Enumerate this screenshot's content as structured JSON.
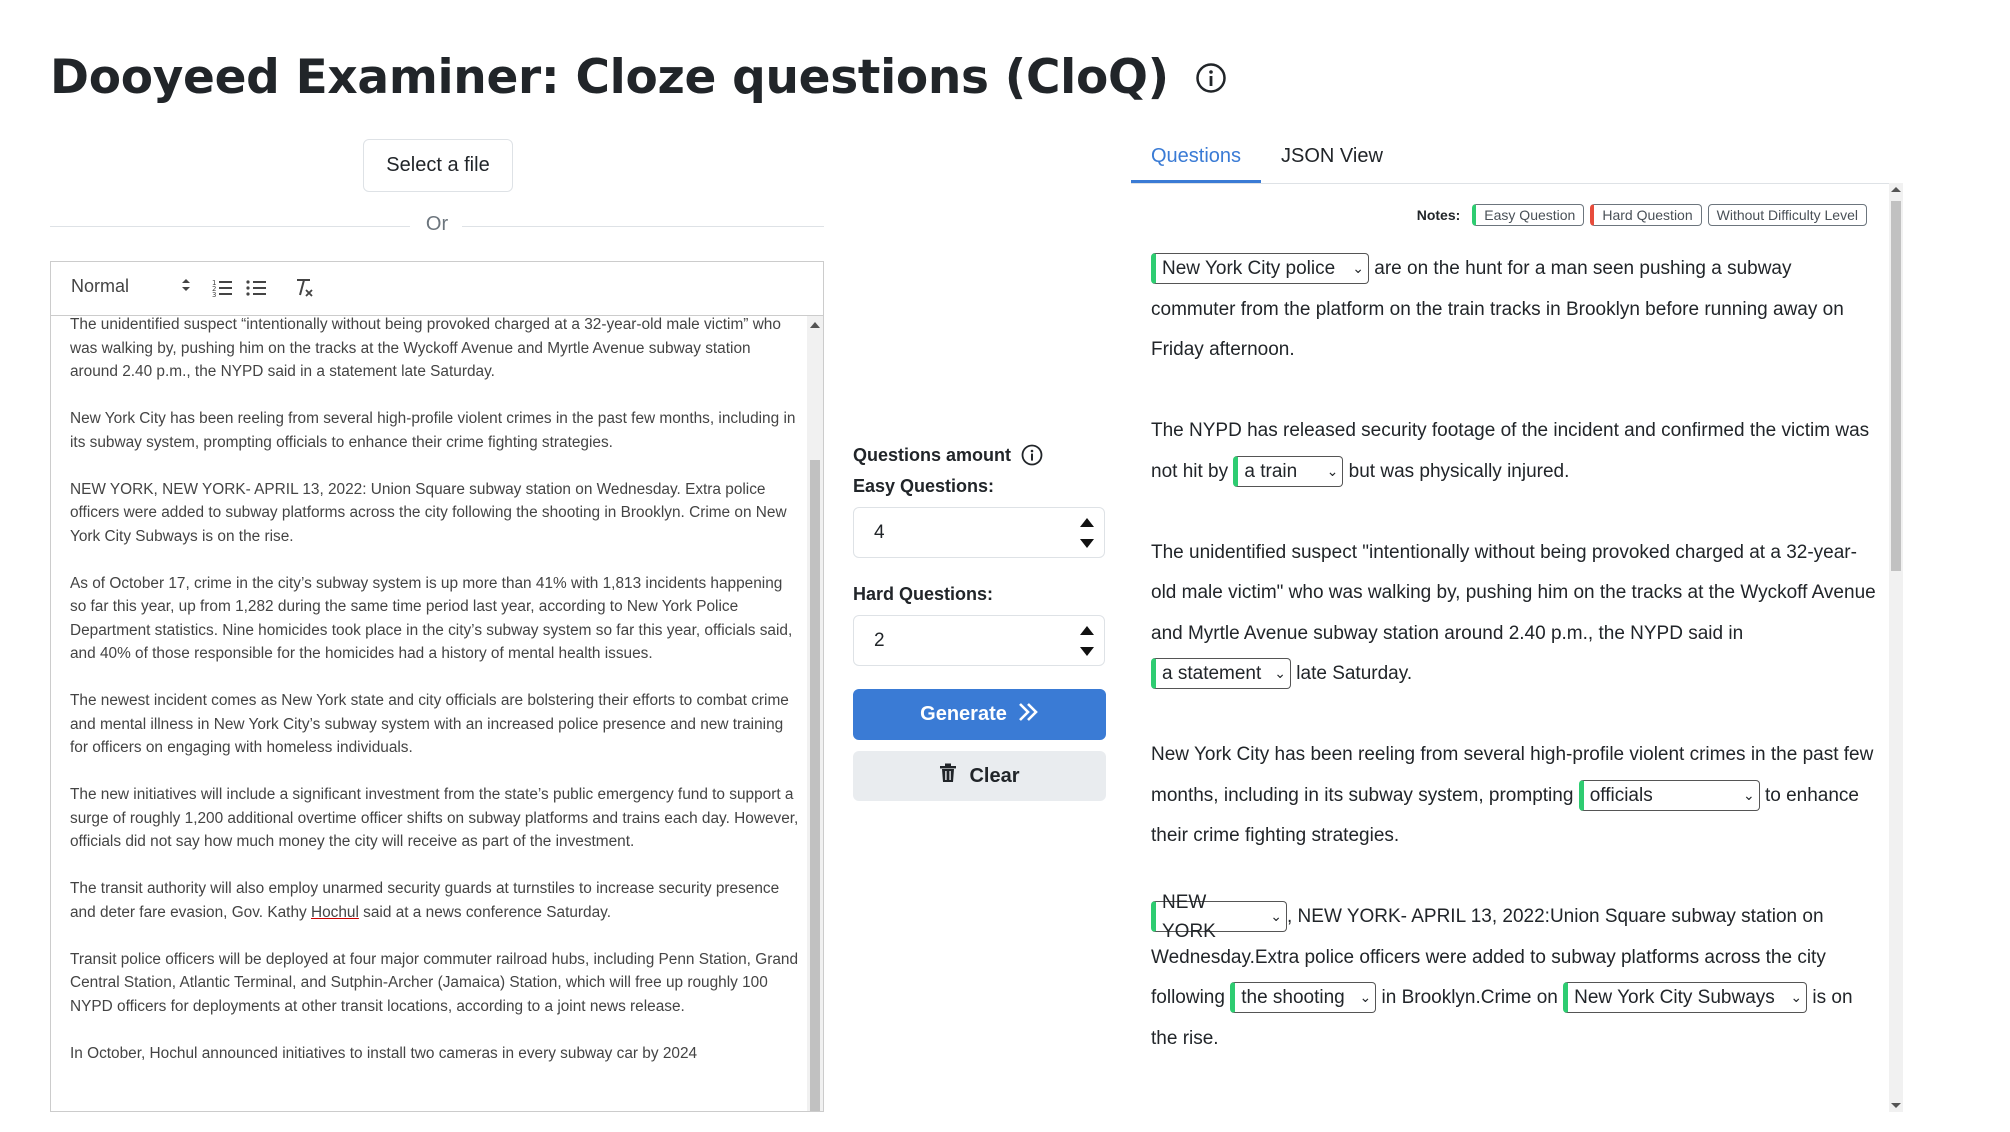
{
  "page": {
    "title": "Dooyeed Examiner: Cloze questions (CloQ)"
  },
  "left": {
    "select_file_label": "Select a file",
    "or_label": "Or",
    "format_label": "Normal",
    "paragraphs": [
      "The unidentified suspect “intentionally without being provoked charged at a 32-year-old male victim” who was walking by, pushing him on the tracks at the Wyckoff Avenue and Myrtle Avenue subway station around 2.40 p.m., the NYPD said in a statement late Saturday.",
      "New York City has been reeling from several high-profile violent crimes in the past few months, including in its subway system, prompting officials to enhance their crime fighting strategies.",
      "NEW YORK, NEW YORK- APRIL 13, 2022: Union Square subway station on Wednesday. Extra police officers were added to subway platforms across the city following the shooting in Brooklyn. Crime on New York City Subways is on the rise.",
      "As of October 17, crime in the city’s subway system is up more than 41% with 1,813 incidents happening so far this year, up from 1,282 during the same time period last year, according to New York Police Department statistics. Nine homicides took place in the city’s subway system so far this year, officials said, and 40% of those responsible for the homicides had a history of mental health issues.",
      "The newest incident comes as New York state and city officials are bolstering their efforts to combat crime and mental illness in New York City’s subway system with an increased police presence and new training for officers on engaging with homeless individuals.",
      "The new initiatives will include a significant investment from the state’s public emergency fund to support a surge of roughly 1,200 additional overtime officer shifts on subway platforms and trains each day. However, officials did not say how much money the city will receive as part of the investment.",
      {
        "before": "The transit authority will also employ unarmed security guards at turnstiles to increase security presence and deter fare evasion, Gov. Kathy ",
        "underlined": "Hochul",
        "after": " said at a news conference Saturday."
      },
      "Transit police officers will be deployed at four major commuter railroad hubs, including Penn Station, Grand Central Station, Atlantic Terminal, and Sutphin-Archer (Jamaica) Station, which will free up roughly 100 NYPD officers for deployments at other transit locations, according to a joint news release.",
      "In October, Hochul announced initiatives to install two cameras in every subway car by 2024"
    ]
  },
  "middle": {
    "questions_amount_label": "Questions amount",
    "easy_label": "Easy Questions:",
    "easy_value": "4",
    "hard_label": "Hard Questions:",
    "hard_value": "2",
    "generate_label": "Generate",
    "clear_label": "Clear"
  },
  "right": {
    "tabs": [
      "Questions",
      "JSON View"
    ],
    "notes_label": "Notes:",
    "notes": [
      "Easy Question",
      "Hard Question",
      "Without Difficulty Level"
    ],
    "colors": {
      "easy": "#2ecc71",
      "hard": "#e74c3c",
      "accent": "#3a7bd5"
    },
    "p1": {
      "blank": "New York City police",
      "after": " are on the hunt for a man seen pushing a subway commuter from the platform on the train tracks in Brooklyn before running away on Friday afternoon."
    },
    "p2": {
      "before": "The NYPD has released security footage of the incident and confirmed the victim was not hit by ",
      "blank": "a train",
      "after": " but was physically injured."
    },
    "p3": {
      "before": "The unidentified suspect \"intentionally without being provoked charged at a 32-year-old male victim\" who was walking by, pushing him on the tracks at the Wyckoff Avenue and Myrtle Avenue subway station around 2.40 p.m., the NYPD said in ",
      "blank": "a statement",
      "after": " late Saturday."
    },
    "p4": {
      "before": "New York City has been reeling from several high-profile violent crimes in the past few months, including in its subway system, prompting ",
      "blank": "officials",
      "after": " to enhance their crime fighting strategies."
    },
    "p5": {
      "blank1": "NEW YORK",
      "mid1": ", NEW YORK- APRIL 13, 2022:Union Square subway station on Wednesday.Extra police officers were added to subway platforms across the city following ",
      "blank2": "the shooting",
      "mid2": " in Brooklyn.Crime on ",
      "blank3": "New York City Subways",
      "after": " is on the rise."
    }
  }
}
